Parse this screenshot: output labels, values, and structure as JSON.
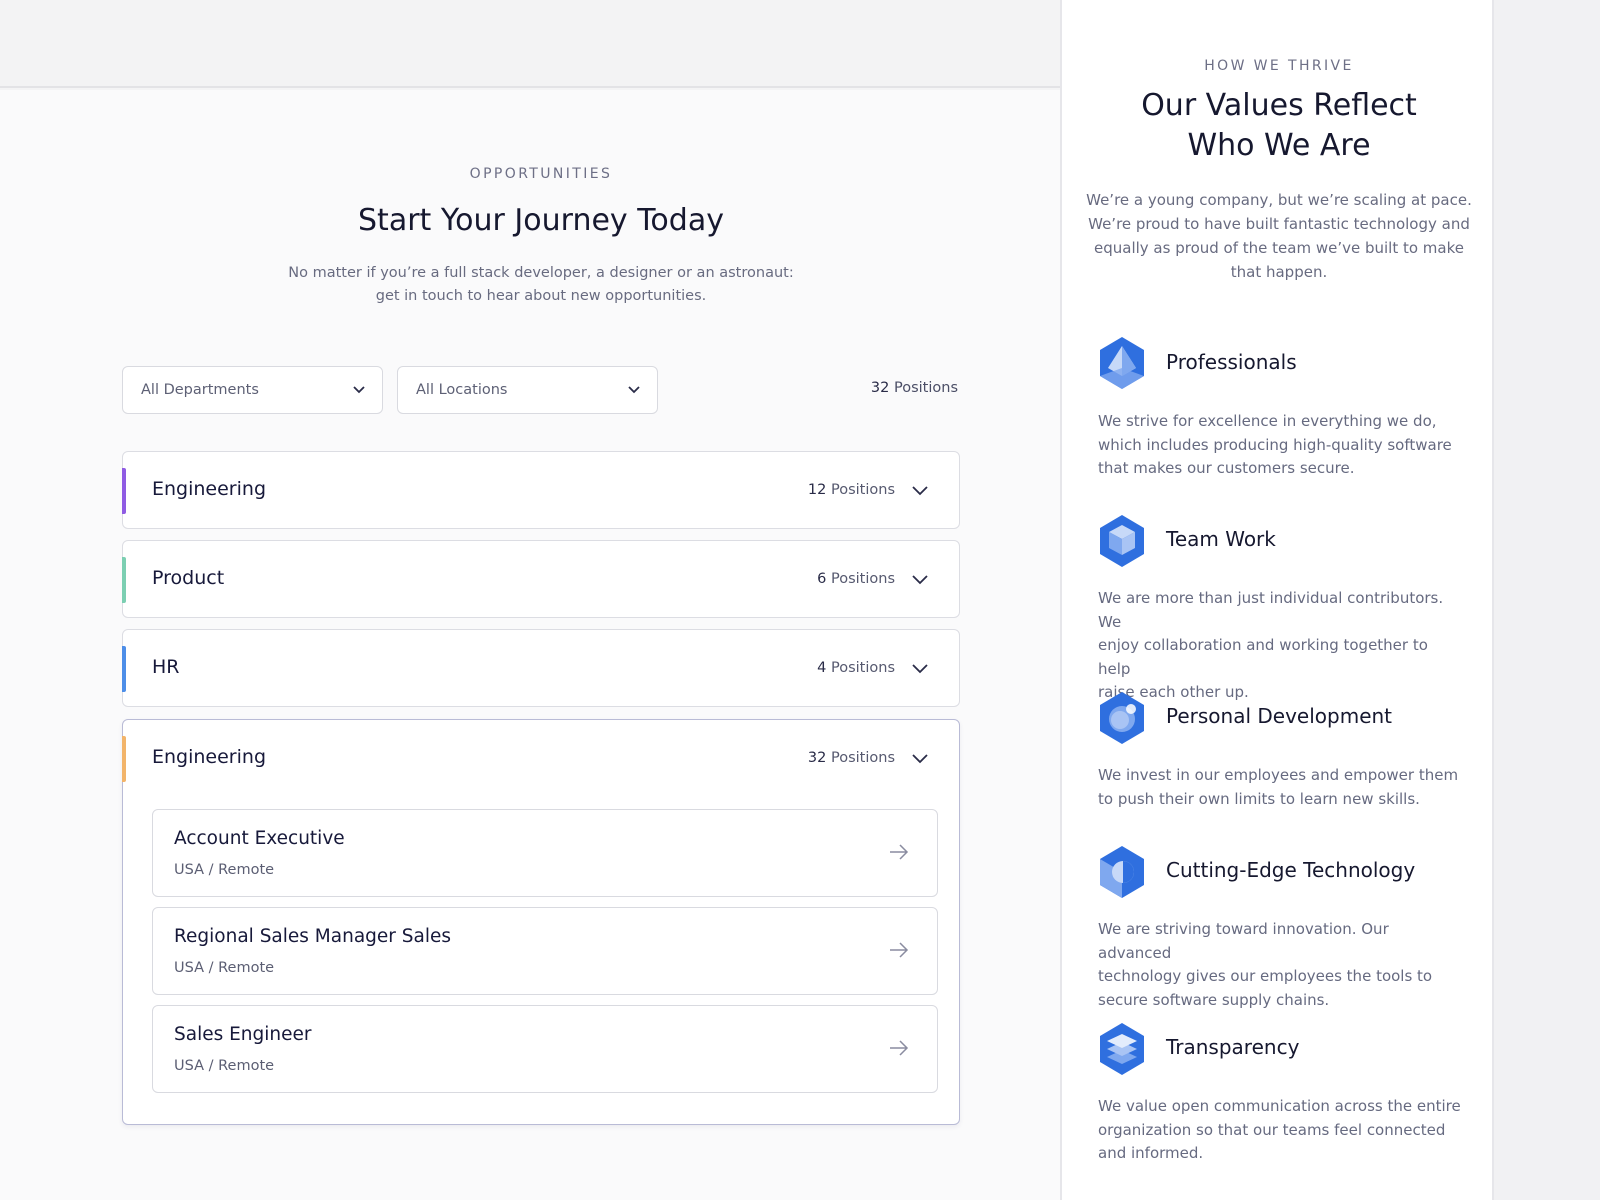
{
  "opportunities": {
    "eyebrow": "OPPORTUNITIES",
    "title": "Start Your Journey Today",
    "subtitle_line1": "No matter if you’re a full stack developer, a designer or an astronaut:",
    "subtitle_line2": "get in touch to hear about new opportunities.",
    "filters": {
      "department": "All Departments",
      "location": "All Locations"
    },
    "total_count": "32",
    "positions_word": "Positions",
    "departments": [
      {
        "name": "Engineering",
        "count": "12",
        "accent": "#8f5be3"
      },
      {
        "name": "Product",
        "count": "6",
        "accent": "#7ccfb2"
      },
      {
        "name": "HR",
        "count": "4",
        "accent": "#4d8ee8"
      }
    ],
    "open_department": {
      "name": "Engineering",
      "count": "32",
      "accent": "#f2b46a",
      "jobs": [
        {
          "title": "Account Executive",
          "location": "USA / Remote"
        },
        {
          "title": "Regional Sales Manager Sales",
          "location": "USA / Remote"
        },
        {
          "title": "Sales Engineer",
          "location": "USA / Remote"
        }
      ]
    }
  },
  "values": {
    "eyebrow": "HOW WE THRIVE",
    "title_line1": "Our Values Reflect",
    "title_line2": "Who We Are",
    "intro_lines": [
      "We’re a young company, but we’re scaling at pace.",
      "We’re proud to have built fantastic technology and",
      "equally as proud of the team we’ve built to make",
      "that happen."
    ],
    "items": [
      {
        "title": "Professionals",
        "icon": "pyramid-hex-icon",
        "lines": [
          "We strive for excellence in everything we do,",
          "which includes producing high-quality software",
          "that makes our customers secure."
        ]
      },
      {
        "title": "Team Work",
        "icon": "cube-hex-icon",
        "lines": [
          "We are more than just individual contributors. We",
          "enjoy collaboration and working together to help",
          "raise each other up."
        ]
      },
      {
        "title": "Personal Development",
        "icon": "orbit-hex-icon",
        "lines": [
          "We invest in our employees and empower them",
          "to push their own limits to learn new skills."
        ]
      },
      {
        "title": "Cutting-Edge Technology",
        "icon": "moon-hex-icon",
        "lines": [
          "We are striving toward innovation. Our advanced",
          "technology gives our employees the tools to",
          "secure software supply chains."
        ]
      },
      {
        "title": "Transparency",
        "icon": "layers-hex-icon",
        "lines": [
          "We value open communication across the entire",
          "organization so that our teams feel connected",
          "and informed."
        ]
      }
    ],
    "icon_colors": {
      "primary": "#2f6fdf",
      "light": "#7fa8ef",
      "pale": "#c7d9f8"
    }
  }
}
